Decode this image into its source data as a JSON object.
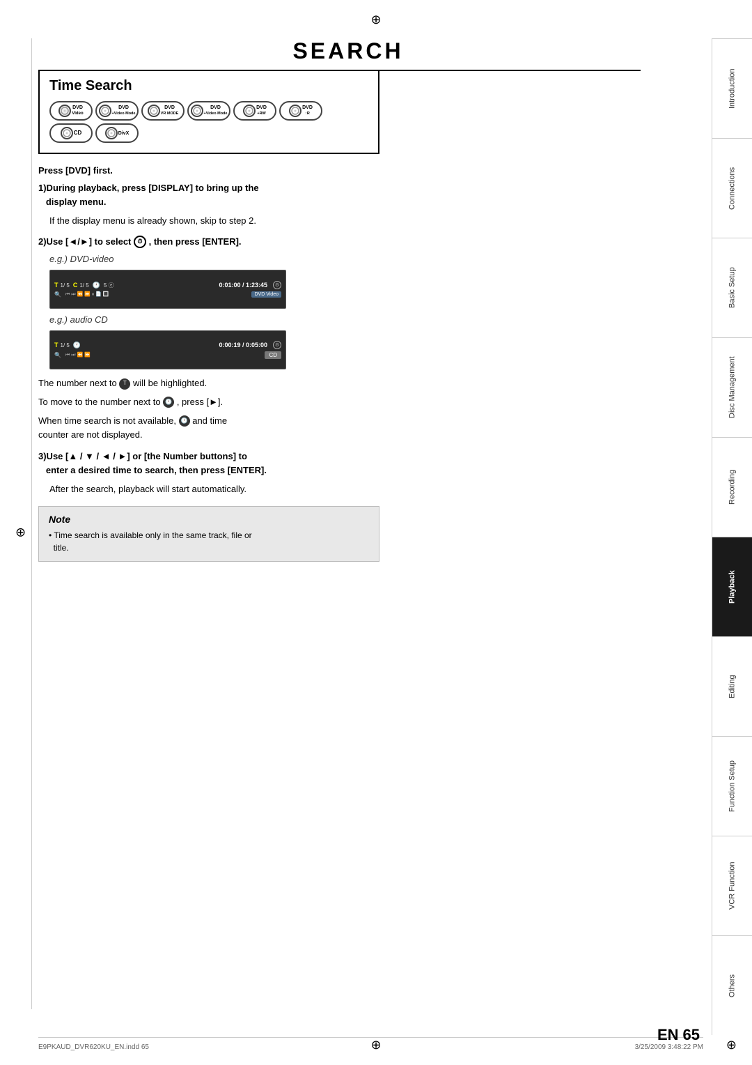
{
  "page": {
    "title": "SEARCH",
    "page_number": "65",
    "lang_label": "EN",
    "footer_left": "E9PKAUD_DVR620KU_EN.indd  65",
    "footer_right": "3/25/2009  3:48:22 PM"
  },
  "sidebar": {
    "items": [
      {
        "label": "Introduction",
        "active": false
      },
      {
        "label": "Connections",
        "active": false
      },
      {
        "label": "Basic Setup",
        "active": false
      },
      {
        "label": "Disc Management",
        "active": false
      },
      {
        "label": "Recording",
        "active": false
      },
      {
        "label": "Playback",
        "active": true
      },
      {
        "label": "Editing",
        "active": false
      },
      {
        "label": "Function Setup",
        "active": false
      },
      {
        "label": "VCR Function",
        "active": false
      },
      {
        "label": "Others",
        "active": false
      }
    ]
  },
  "time_search": {
    "title": "Time Search",
    "disc_icons": [
      {
        "id": "dvd-video",
        "top": "DVD",
        "bottom": "Video"
      },
      {
        "id": "dvd-svideo",
        "top": "DVD",
        "bottom": "+Video Mode"
      },
      {
        "id": "dvd-vr",
        "top": "DVD",
        "bottom": "VR MODE"
      },
      {
        "id": "dvd-plus-video",
        "top": "DVD",
        "bottom": "+Video Mode"
      },
      {
        "id": "dvd-plus-rw",
        "top": "DVD",
        "bottom": "+RW"
      },
      {
        "id": "dvd-r",
        "top": "DVD",
        "bottom": "↑R"
      }
    ],
    "disc_row2": [
      {
        "id": "cd",
        "label": "CD"
      },
      {
        "id": "divx",
        "label": "DivX"
      }
    ],
    "press_dvd_first": "Press [DVD] first.",
    "step1_bold": "1)During playback, press [DISPLAY] to bring up the\n   display menu.",
    "step1_sub": "If the display menu is already shown, skip to step 2.",
    "step2_bold": "2)Use [◄/►] to select",
    "step2_suffix": ", then press [ENTER].",
    "step2_eg1": "e.g.) DVD-video",
    "display1_top": "0:01:00 / 1:23:45",
    "display1_label": "DVD Video",
    "step2_eg2": "e.g.) audio CD",
    "display2_top": "0:00:19 / 0:05:00",
    "display2_label": "CD",
    "para1": "The number next to",
    "para1_suffix": "will be highlighted.",
    "para2": "To move to the number next to",
    "para2_suffix": ", press [►].",
    "para3_prefix": "When time search is not available,",
    "para3_suffix": "and time\ncounter are not displayed.",
    "step3_bold": "3)Use [▲ / ▼ / ◄ / ►] or [the Number buttons] to\n   enter a desired time to search, then press [ENTER].",
    "step3_sub": "After the search, playback will start automatically.",
    "note_title": "Note",
    "note_text": "• Time search is available only in the same track, file or\n  title."
  }
}
